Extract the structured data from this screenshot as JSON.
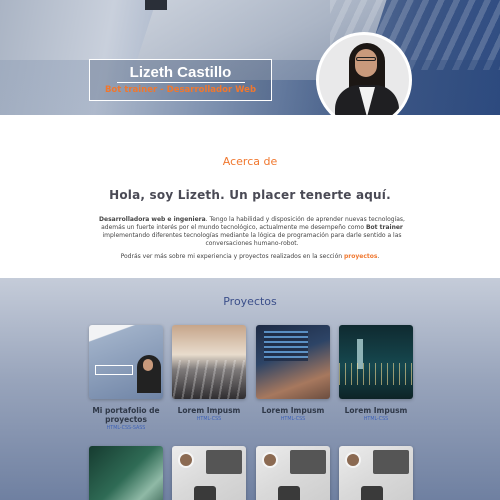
{
  "hero": {
    "name": "Lizeth Castillo",
    "role": "Bot trainer - Desarrollador Web"
  },
  "about": {
    "heading": "Acerca de",
    "greeting": "Hola, soy Lizeth. Un placer tenerte aquí.",
    "bio_strong": "Desarrolladora web e ingeniera",
    "bio_part1": ". Tengo la habilidad y disposición de aprender nuevas tecnologías, además un fuerte interés por el mundo tecnológico, actualmente me desempeño como ",
    "bio_role": "Bot trainer",
    "bio_part2": " implementando diferentes tecnologías mediante la lógica de programación para darle sentido a las conversaciones humano-robot.",
    "more_text": "Podrás ver más sobre mi experiencia y proyectos realizados en la sección ",
    "more_link": "proyectos",
    "more_end": "."
  },
  "projects": {
    "heading": "Proyectos",
    "items": [
      {
        "title": "Mi portafolio de proyectos",
        "tech": "HTML-CSS-SASS"
      },
      {
        "title": "Lorem Impusm",
        "tech": "HTML-CSS"
      },
      {
        "title": "Lorem Impusm",
        "tech": "HTML-CSS"
      },
      {
        "title": "Lorem Impusm",
        "tech": "HTML-CSS"
      }
    ]
  },
  "colors": {
    "accent": "#f0772e",
    "heading_blue": "#3b4f8a",
    "tech_blue": "#3f63b8"
  }
}
